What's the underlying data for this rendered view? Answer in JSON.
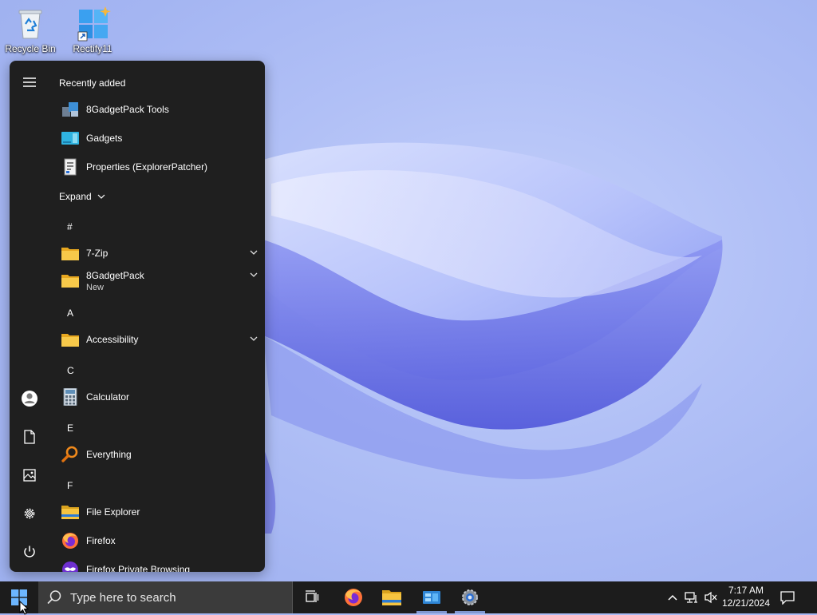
{
  "desktop": {
    "icons": [
      {
        "label": "Recycle Bin",
        "icon": "recycle-bin-icon"
      },
      {
        "label": "Rectify11",
        "icon": "rectify11-shortcut-icon"
      }
    ]
  },
  "start_menu": {
    "recently_added_label": "Recently added",
    "recent": [
      {
        "name": "8GadgetPack Tools",
        "icon": "8gadgetpack-tools-icon"
      },
      {
        "name": "Gadgets",
        "icon": "gadgets-icon"
      },
      {
        "name": "Properties (ExplorerPatcher)",
        "icon": "properties-icon"
      }
    ],
    "expand_label": "Expand",
    "letters": {
      "hash": "#",
      "a": "A",
      "c": "C",
      "e": "E",
      "f": "F"
    },
    "apps": {
      "zip7": {
        "name": "7-Zip"
      },
      "gadgetpack": {
        "name": "8GadgetPack",
        "sub": "New"
      },
      "accessibility": {
        "name": "Accessibility"
      },
      "calculator": {
        "name": "Calculator"
      },
      "everything": {
        "name": "Everything"
      },
      "file_explorer": {
        "name": "File Explorer"
      },
      "firefox": {
        "name": "Firefox"
      },
      "firefox_private": {
        "name": "Firefox Private Browsing"
      }
    },
    "rail": [
      "hamburger-menu-icon",
      "user-avatar-icon",
      "documents-icon",
      "pictures-icon",
      "settings-icon",
      "power-icon"
    ]
  },
  "taskbar": {
    "search_placeholder": "Type here to search",
    "apps": [
      "task-view-icon",
      "firefox-icon",
      "file-explorer-icon",
      "control-panel-icon",
      "settings-icon"
    ],
    "clock": {
      "time": "7:17 AM",
      "date": "12/21/2024"
    }
  },
  "colors": {
    "menu_bg": "#1f1f1f",
    "taskbar_bg": "#1c1c1c",
    "search_bg": "#3b3b3b",
    "accent": "#4a8cff",
    "folder": "#f5c542"
  }
}
